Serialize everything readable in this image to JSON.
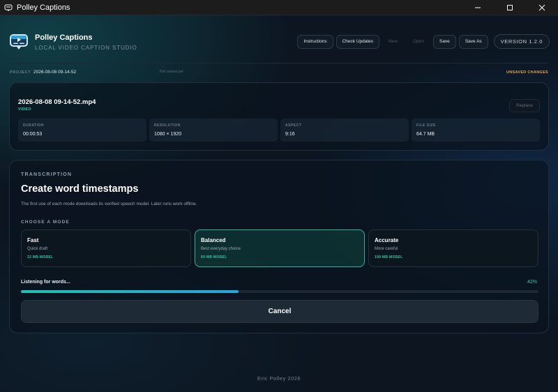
{
  "window": {
    "title": "Polley Captions"
  },
  "header": {
    "app_name": "Polley Captions",
    "subtitle": "LOCAL VIDEO CAPTION STUDIO",
    "toolbar": {
      "instructions": "Instructions",
      "check_updates": "Check Updates",
      "new": "New",
      "open": "Open",
      "save": "Save",
      "save_as": "Save As"
    },
    "version": "VERSION 1.2.0"
  },
  "project": {
    "label": "PROJECT",
    "name": "2026-08-08 09-14-52",
    "save_status": "Not saved yet",
    "unsaved": "UNSAVED CHANGES"
  },
  "video": {
    "filename": "2026-08-08 09-14-52.mp4",
    "type": "VIDEO",
    "replace_label": "Replace",
    "stats": [
      {
        "label": "DURATION",
        "value": "00:00:53"
      },
      {
        "label": "RESOLUTION",
        "value": "1080 × 1920"
      },
      {
        "label": "ASPECT",
        "value": "9:16"
      },
      {
        "label": "FILE SIZE",
        "value": "64.7 MB"
      }
    ]
  },
  "transcription": {
    "eyebrow": "TRANSCRIPTION",
    "title": "Create word timestamps",
    "description": "The first use of each mode downloads its verified speech model. Later runs work offline.",
    "mode_eyebrow": "CHOOSE A MODE",
    "modes": [
      {
        "name": "Fast",
        "desc": "Quick draft",
        "size": "32 MB MODEL",
        "selected": false
      },
      {
        "name": "Balanced",
        "desc": "Best everyday choice",
        "size": "60 MB MODEL",
        "selected": true
      },
      {
        "name": "Accurate",
        "desc": "More careful",
        "size": "190 MB MODEL",
        "selected": false
      }
    ],
    "progress_label": "Listening for words...",
    "progress_percent_text": "42%",
    "progress_value": 0.42,
    "cancel_label": "Cancel"
  },
  "footer": {
    "text": "Eric Polley 2026"
  },
  "colors": {
    "accent": "#28c7a8",
    "warning": "#e3a24a",
    "background": "#0c1520"
  }
}
